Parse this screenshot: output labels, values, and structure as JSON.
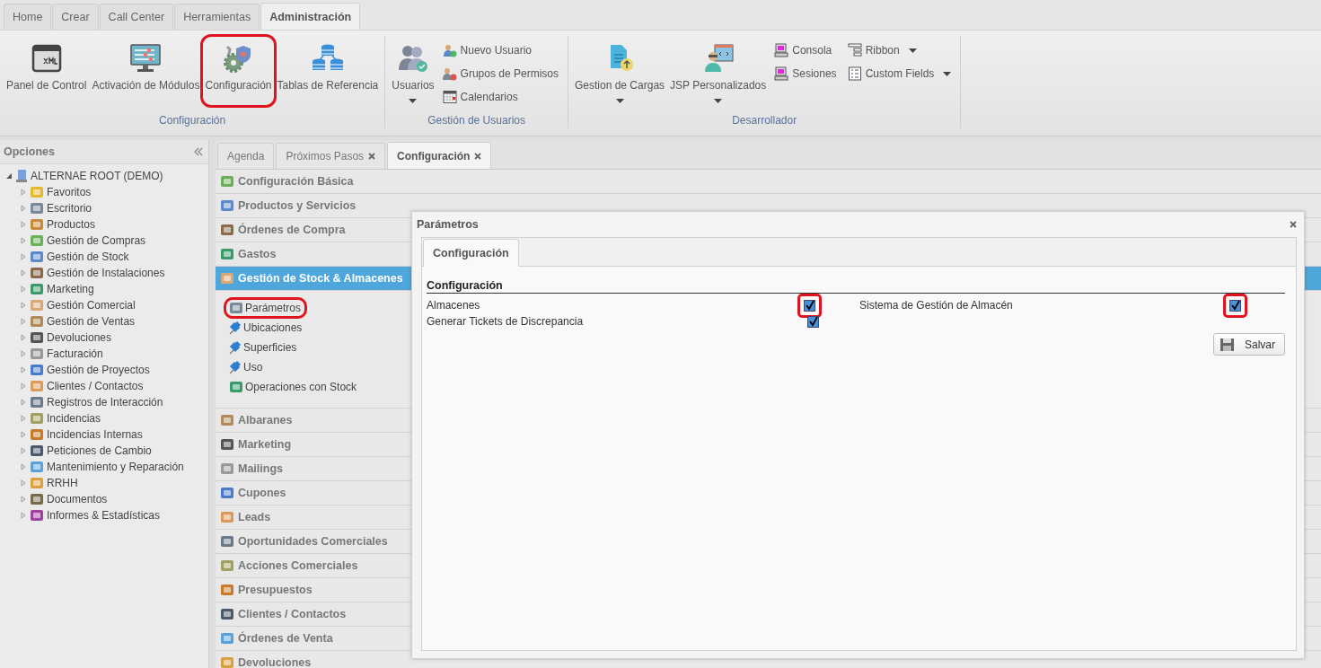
{
  "top_tabs": [
    {
      "label": "Home",
      "selected": false
    },
    {
      "label": "Crear",
      "selected": false
    },
    {
      "label": "Call Center",
      "selected": false
    },
    {
      "label": "Herramientas",
      "selected": false
    },
    {
      "label": "Administración",
      "selected": true
    }
  ],
  "ribbon": {
    "groups": [
      {
        "title": "Configuración",
        "large_items": [
          {
            "label": "Panel de Control",
            "dropdown": false,
            "highlighted": false
          },
          {
            "label": "Activación de Módulos",
            "dropdown": false,
            "highlighted": false
          },
          {
            "label": "Configuración",
            "dropdown": false,
            "highlighted": true
          },
          {
            "label": "Tablas de Referencia",
            "dropdown": false,
            "highlighted": false
          }
        ]
      },
      {
        "title": "Gestión de Usuarios",
        "large_items": [
          {
            "label": "Usuarios",
            "dropdown": true,
            "highlighted": false
          }
        ],
        "small_columns": [
          [
            {
              "label": "Nuevo Usuario",
              "dropdown": false
            },
            {
              "label": "Grupos de Permisos",
              "dropdown": false
            },
            {
              "label": "Calendarios",
              "dropdown": false
            }
          ]
        ]
      },
      {
        "title": "Desarrollador",
        "large_items": [
          {
            "label": "Gestion de Cargas",
            "dropdown": true,
            "highlighted": false
          },
          {
            "label": "JSP Personalizados",
            "dropdown": true,
            "highlighted": false
          }
        ],
        "small_columns": [
          [
            {
              "label": "Consola",
              "dropdown": false
            },
            {
              "label": "Sesiones",
              "dropdown": false
            }
          ],
          [
            {
              "label": "Ribbon",
              "dropdown": true
            },
            {
              "label": "Custom Fields",
              "dropdown": true
            }
          ]
        ]
      }
    ]
  },
  "sidebar": {
    "title": "Opciones",
    "root": {
      "label": "ALTERNAE ROOT (DEMO)",
      "expanded": true,
      "children": [
        {
          "label": "Favoritos",
          "expanded": false
        },
        {
          "label": "Escritorio",
          "expanded": false
        },
        {
          "label": "Productos",
          "expanded": false
        },
        {
          "label": "Gestión de Compras",
          "expanded": false
        },
        {
          "label": "Gestión de Stock",
          "expanded": false
        },
        {
          "label": "Gestión de Instalaciones",
          "expanded": false
        },
        {
          "label": "Marketing",
          "expanded": false
        },
        {
          "label": "Gestión Comercial",
          "expanded": false
        },
        {
          "label": "Gestión de Ventas",
          "expanded": false
        },
        {
          "label": "Devoluciones",
          "expanded": false
        },
        {
          "label": "Facturación",
          "expanded": false
        },
        {
          "label": "Gestión de Proyectos",
          "expanded": false
        },
        {
          "label": "Clientes / Contactos",
          "expanded": false
        },
        {
          "label": "Registros de Interacción",
          "expanded": false
        },
        {
          "label": "Incidencias",
          "expanded": false
        },
        {
          "label": "Incidencias Internas",
          "expanded": false
        },
        {
          "label": "Peticiones de Cambio",
          "expanded": false
        },
        {
          "label": "Mantenimiento y Reparación",
          "expanded": false
        },
        {
          "label": "RRHH",
          "expanded": false
        },
        {
          "label": "Documentos",
          "expanded": false
        },
        {
          "label": "Informes & Estadísticas",
          "expanded": false
        }
      ]
    }
  },
  "main_tabs": [
    {
      "label": "Agenda",
      "selected": false,
      "closable": false
    },
    {
      "label": "Próximos Pasos",
      "selected": false,
      "closable": true
    },
    {
      "label": "Configuración",
      "selected": true,
      "closable": true
    }
  ],
  "accordion": [
    {
      "label": "Configuración Básica",
      "selected": false
    },
    {
      "label": "Productos y Servicios",
      "selected": false
    },
    {
      "label": "Órdenes de Compra",
      "selected": false
    },
    {
      "label": "Gastos",
      "selected": false
    },
    {
      "label": "Gestión de Stock & Almacenes",
      "selected": true,
      "items": [
        {
          "label": "Parámetros",
          "highlighted": true
        },
        {
          "label": "Ubicaciones",
          "highlighted": false
        },
        {
          "label": "Superficies",
          "highlighted": false
        },
        {
          "label": "Uso",
          "highlighted": false
        },
        {
          "label": "Operaciones con Stock",
          "highlighted": false
        }
      ]
    },
    {
      "label": "Albaranes",
      "selected": false
    },
    {
      "label": "Marketing",
      "selected": false
    },
    {
      "label": "Mailings",
      "selected": false
    },
    {
      "label": "Cupones",
      "selected": false
    },
    {
      "label": "Leads",
      "selected": false
    },
    {
      "label": "Oportunidades Comerciales",
      "selected": false
    },
    {
      "label": "Acciones Comerciales",
      "selected": false
    },
    {
      "label": "Presupuestos",
      "selected": false
    },
    {
      "label": "Clientes / Contactos",
      "selected": false
    },
    {
      "label": "Órdenes de Venta",
      "selected": false
    },
    {
      "label": "Devoluciones",
      "selected": false
    }
  ],
  "dialog": {
    "title": "Parámetros",
    "tabs": [
      {
        "label": "Configuración",
        "selected": true
      }
    ],
    "section": "Configuración",
    "rows": [
      [
        {
          "label": "Almacenes",
          "checked": true,
          "highlighted": true
        },
        {
          "label": "Sistema de Gestión de Almacén",
          "checked": true,
          "highlighted": true
        }
      ],
      [
        {
          "label": "Generar Tickets de Discrepancia",
          "checked": true,
          "highlighted": false
        }
      ]
    ],
    "save_button": "Salvar"
  }
}
